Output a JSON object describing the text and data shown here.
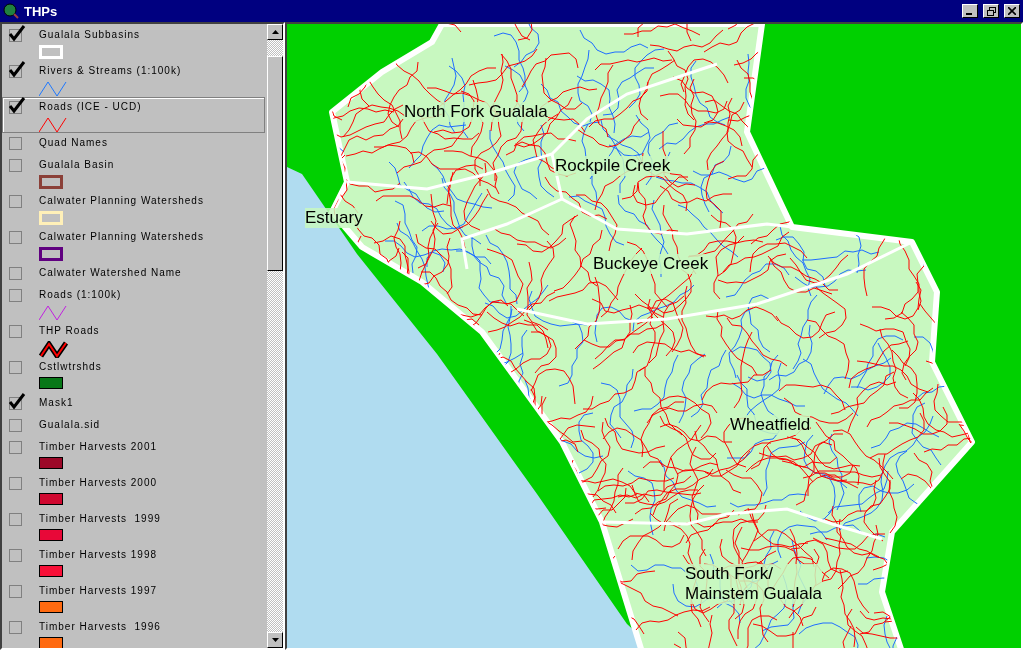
{
  "window": {
    "title": "THPs"
  },
  "legend": {
    "items": [
      {
        "label": "Gualala Subbasins",
        "checked": true,
        "selected": false,
        "kind": "outline",
        "color": "#ffffff"
      },
      {
        "label": "Rivers & Streams (1:100k)",
        "checked": true,
        "selected": false,
        "kind": "line",
        "color": "#1e78ff"
      },
      {
        "label": "Roads (ICE - UCD)",
        "checked": true,
        "selected": true,
        "kind": "line",
        "color": "#ff0000"
      },
      {
        "label": "Quad Names",
        "checked": false,
        "selected": false,
        "kind": "none"
      },
      {
        "label": "Gualala Basin",
        "checked": false,
        "selected": false,
        "kind": "outline",
        "color": "#8b4038"
      },
      {
        "label": "Calwater Planning Watersheds",
        "checked": false,
        "selected": false,
        "kind": "outline",
        "color": "#fff0b8"
      },
      {
        "label": "Calwater Planning Watersheds",
        "checked": false,
        "selected": false,
        "kind": "outline",
        "color": "#600080"
      },
      {
        "label": "Calwater Watershed Name",
        "checked": false,
        "selected": false,
        "kind": "none"
      },
      {
        "label": "Roads (1:100k)",
        "checked": false,
        "selected": false,
        "kind": "line",
        "color": "#c020e0"
      },
      {
        "label": "THP Roads",
        "checked": false,
        "selected": false,
        "kind": "thick-line",
        "color": "#ff0000"
      },
      {
        "label": "Cstlwtrshds",
        "checked": false,
        "selected": false,
        "kind": "fill",
        "color": "#087818"
      },
      {
        "label": "Mask1",
        "checked": true,
        "selected": false,
        "kind": "none"
      },
      {
        "label": "Gualala.sid",
        "checked": false,
        "selected": false,
        "kind": "none"
      },
      {
        "label": "Timber Harvests 2001",
        "checked": false,
        "selected": false,
        "kind": "fill",
        "color": "#9c0828"
      },
      {
        "label": "Timber Harvests 2000",
        "checked": false,
        "selected": false,
        "kind": "fill",
        "color": "#d00830"
      },
      {
        "label": "Timber Harvests  1999",
        "checked": false,
        "selected": false,
        "kind": "fill",
        "color": "#e80838"
      },
      {
        "label": "Timber Harvests 1998",
        "checked": false,
        "selected": false,
        "kind": "fill",
        "color": "#f81038"
      },
      {
        "label": "Timber Harvests 1997",
        "checked": false,
        "selected": false,
        "kind": "fill",
        "color": "#ff6a10"
      },
      {
        "label": "Timber Harvests  1996",
        "checked": false,
        "selected": false,
        "kind": "fill",
        "color": "#ff6a10"
      }
    ]
  },
  "map": {
    "labels": [
      {
        "text": "North Fork Gualala"
      },
      {
        "text": "Rockpile Creek"
      },
      {
        "text": "Estuary"
      },
      {
        "text": "Buckeye Creek"
      },
      {
        "text": "Wheatfield"
      },
      {
        "text": "South Fork/\nMainstem Gualala"
      }
    ]
  }
}
